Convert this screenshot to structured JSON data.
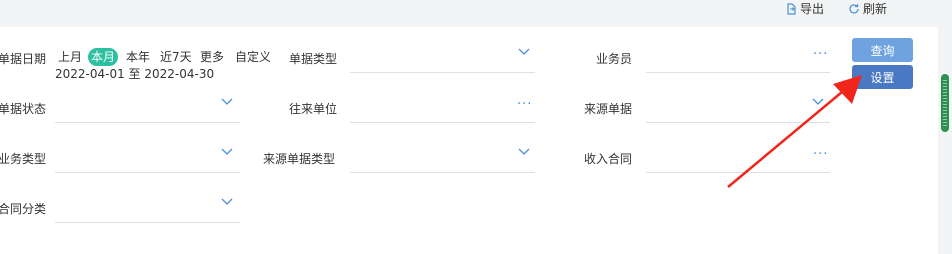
{
  "toolbar": {
    "export_label": "导出",
    "refresh_label": "刷新"
  },
  "form": {
    "doc_date_label": "单据日期",
    "date_options": [
      "上月",
      "本月",
      "本年",
      "近7天",
      "更多",
      "自定义"
    ],
    "active_date_option": "本月",
    "date_range": "2022-04-01 至 2022-04-30",
    "doc_type_label": "单据类型",
    "salesperson_label": "业务员",
    "doc_status_label": "单据状态",
    "counterparty_label": "往来单位",
    "source_doc_label": "来源单据",
    "biz_type_label": "业务类型",
    "source_doc_type_label": "来源单据类型",
    "income_contract_label": "收入合同",
    "contract_category_label": "合同分类",
    "more_glyph": "···"
  },
  "actions": {
    "query_label": "查询",
    "settings_label": "设置"
  },
  "colors": {
    "accent_green": "#2dbfa1",
    "query_blue": "#6fa3e0",
    "settings_blue": "#4a78c2",
    "annotation_red": "#f0261b"
  }
}
